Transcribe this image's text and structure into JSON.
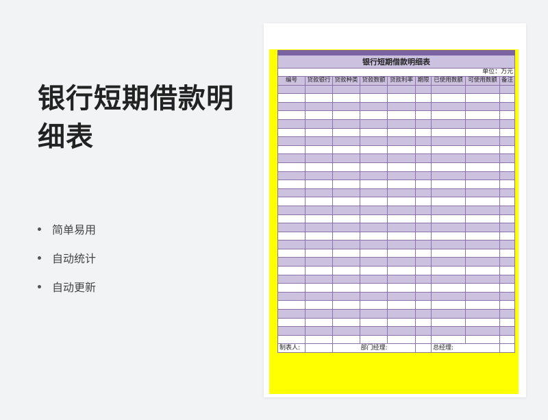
{
  "promo": {
    "title": "银行短期借款明细表",
    "features": [
      "简单易用",
      "自动统计",
      "自动更新"
    ]
  },
  "sheet": {
    "title": "银行短期借款明细表",
    "unit": "单位：万元",
    "headers": [
      "编号",
      "贷款银行",
      "贷款种类",
      "贷款数额",
      "贷款利率",
      "期限",
      "已使用数额",
      "可使用数额",
      "备注"
    ],
    "body_rows": 30,
    "footer": {
      "maker": "制表人:",
      "dept": "部门经理:",
      "gm": "总经理:"
    }
  },
  "colors": {
    "header_purple": "#7b62a0",
    "row_lavender": "#cdc1e0",
    "frame_yellow": "#ffff00"
  }
}
